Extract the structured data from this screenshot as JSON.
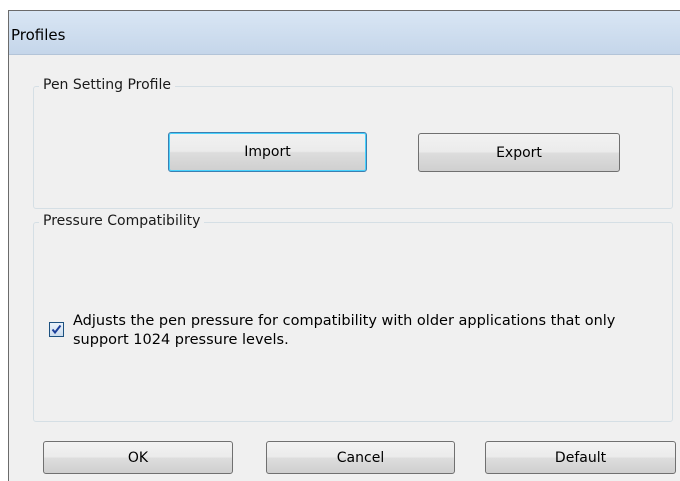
{
  "window": {
    "title": "Profiles"
  },
  "pen_setting_profile": {
    "title": "Pen Setting Profile",
    "import_label": "Import",
    "export_label": "Export"
  },
  "pressure_compatibility": {
    "title": "Pressure Compatibility",
    "checkbox_checked": true,
    "checkbox_label_line1": "Adjusts the pen pressure for compatibility with older applications that only",
    "checkbox_label_line2": "support 1024 pressure levels."
  },
  "footer": {
    "ok_label": "OK",
    "cancel_label": "Cancel",
    "default_label": "Default"
  },
  "colors": {
    "title_bar": "#c5d6ea",
    "dialog_background": "#f0f0f0",
    "focus_border": "#3c7fb1",
    "checkmark": "#1c3f9a"
  }
}
